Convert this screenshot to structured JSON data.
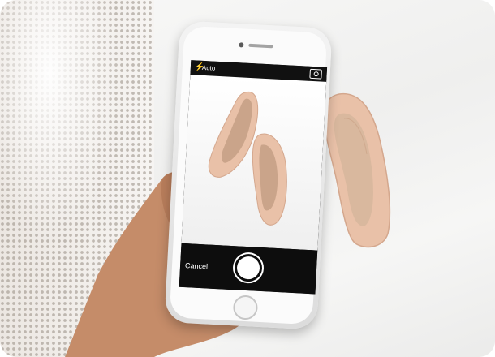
{
  "camera_ui": {
    "flash_label": "Auto",
    "cancel_label": "Cancel"
  },
  "icons": {
    "flash": "lightning-bolt",
    "camera_switch": "camera-switch",
    "shutter": "shutter-button",
    "home": "home-button"
  },
  "colors": {
    "shoe_nude": "#e8bfa6",
    "shoe_inner": "#d9b89e",
    "camera_bar": "#0d0d0d"
  }
}
